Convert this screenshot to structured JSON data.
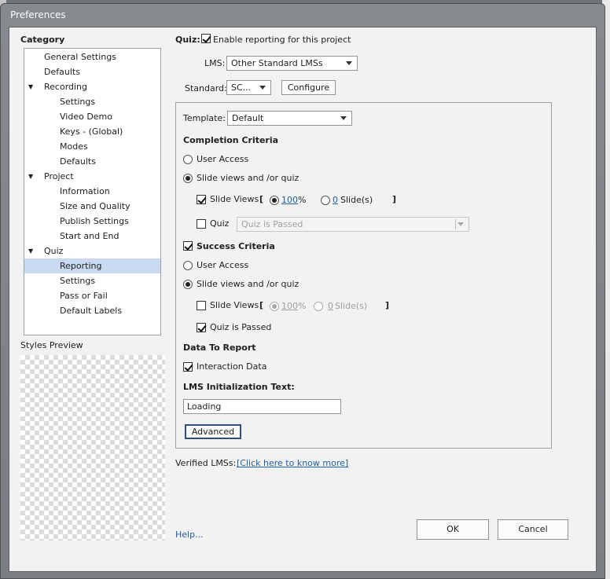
{
  "window": {
    "title": "Preferences"
  },
  "category": {
    "heading": "Category",
    "items": [
      {
        "label": "General Settings",
        "level": 0
      },
      {
        "label": "Defaults",
        "level": 0
      },
      {
        "label": "Recording",
        "level": 0,
        "expanded": true
      },
      {
        "label": "Settings",
        "level": 1
      },
      {
        "label": "Video Demo",
        "level": 1
      },
      {
        "label": "Keys - (Global)",
        "level": 1
      },
      {
        "label": "Modes",
        "level": 1
      },
      {
        "label": "Defaults",
        "level": 1
      },
      {
        "label": "Project",
        "level": 0,
        "expanded": true
      },
      {
        "label": "Information",
        "level": 1
      },
      {
        "label": "Size and Quality",
        "level": 1
      },
      {
        "label": "Publish Settings",
        "level": 1
      },
      {
        "label": "Start and End",
        "level": 1
      },
      {
        "label": "Quiz",
        "level": 0,
        "expanded": true
      },
      {
        "label": "Reporting",
        "level": 1,
        "selected": true
      },
      {
        "label": "Settings",
        "level": 1
      },
      {
        "label": "Pass or Fail",
        "level": 1
      },
      {
        "label": "Default Labels",
        "level": 1
      }
    ],
    "expand_glyph": "▼"
  },
  "styles_preview": {
    "label": "Styles Preview"
  },
  "quiz": {
    "label": "Quiz:",
    "enable_reporting": {
      "label": "Enable reporting for this project",
      "checked": true
    },
    "lms": {
      "label": "LMS:",
      "value": "Other Standard LMSs"
    },
    "standard": {
      "label": "Standard:",
      "value": "SC...",
      "configure_label": "Configure"
    }
  },
  "template": {
    "label": "Template:",
    "value": "Default"
  },
  "completion": {
    "heading": "Completion Criteria",
    "user_access": {
      "label": "User Access",
      "selected": false
    },
    "slide_views_quiz": {
      "label": "Slide views and /or quiz",
      "selected": true
    },
    "slide_views": {
      "label": "Slide Views",
      "checked": true,
      "open_bracket": "[",
      "close_bracket": "]",
      "percent_value": "100",
      "percent_unit": "%",
      "slides_value": "0",
      "slides_unit": "Slide(s)",
      "percent_selected": true
    },
    "quiz": {
      "label": "Quiz",
      "checked": false,
      "value": "Quiz is Passed"
    }
  },
  "success": {
    "heading": "Success Criteria",
    "checked": true,
    "user_access": {
      "label": "User Access",
      "selected": false
    },
    "slide_views_quiz": {
      "label": "Slide views and /or quiz",
      "selected": true
    },
    "slide_views": {
      "label": "Slide Views",
      "checked": false,
      "open_bracket": "[",
      "close_bracket": "]",
      "percent_value": "100",
      "percent_unit": "%",
      "slides_value": "0",
      "slides_unit": "Slide(s)"
    },
    "quiz_passed": {
      "label": "Quiz is Passed",
      "checked": true
    }
  },
  "data_to_report": {
    "heading": "Data To Report",
    "interaction_data": {
      "label": "Interaction Data",
      "checked": true
    }
  },
  "lms_init": {
    "heading": "LMS Initialization Text:",
    "value": "Loading"
  },
  "advanced_label": "Advanced",
  "verified": {
    "label": "Verified LMSs:",
    "link": "[Click here to know more]"
  },
  "help_label": "Help...",
  "ok_label": "OK",
  "cancel_label": "Cancel"
}
